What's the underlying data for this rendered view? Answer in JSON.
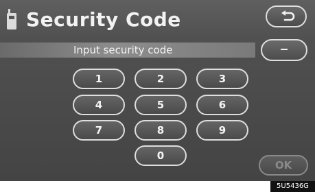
{
  "header": {
    "title": "Security Code"
  },
  "input": {
    "label": "Input security code",
    "clear_label": "-"
  },
  "keypad": {
    "keys": [
      "1",
      "2",
      "3",
      "4",
      "5",
      "6",
      "7",
      "8",
      "9",
      "0"
    ]
  },
  "actions": {
    "ok_label": "OK"
  },
  "footer": {
    "reference_code": "5U5436G"
  },
  "colors": {
    "screen_background": "#4f4f4f",
    "button_border": "#dedede",
    "text": "#f4f4f4",
    "disabled": "#8a8a8a"
  },
  "icons": {
    "title_icon": "phone-icon",
    "back_icon": "return-arrow-icon"
  }
}
